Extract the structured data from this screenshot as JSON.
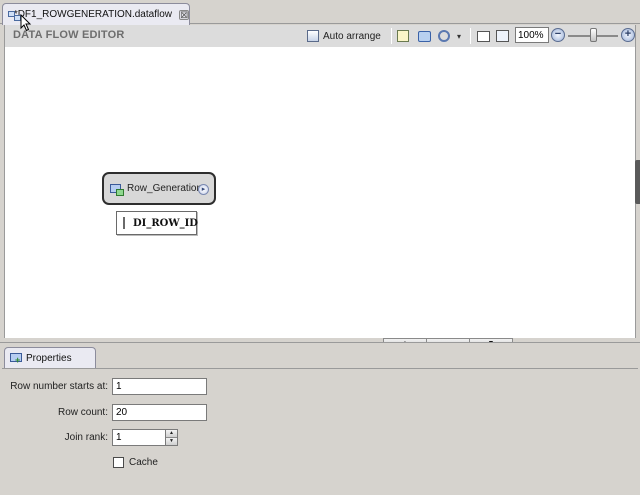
{
  "editor_tab": {
    "title": "*DF1_ROWGENERATION.dataflow",
    "close": "⊠"
  },
  "editor": {
    "title": "DATA FLOW EDITOR",
    "toolbar": {
      "auto_arrange": "Auto arrange",
      "dropdown_arrow": "▾",
      "zoom_value": "100%",
      "zoom_out": "−",
      "zoom_in": "+"
    }
  },
  "canvas": {
    "node": {
      "label": "Row_Generation",
      "port_glyph": "▸"
    },
    "column": {
      "label": "DI_ROW_ID"
    }
  },
  "splitter": {
    "up": "▲",
    "middle": "—",
    "down": "▼"
  },
  "properties": {
    "tab_label": "Properties",
    "fields": {
      "row_number_starts_at": {
        "label": "Row number starts at:",
        "value": "1"
      },
      "row_count": {
        "label": "Row count:",
        "value": "20"
      },
      "join_rank": {
        "label": "Join rank:",
        "value": "1"
      }
    },
    "spin_up": "▲",
    "spin_down": "▼",
    "cache": {
      "label": "Cache",
      "checked": false
    }
  }
}
